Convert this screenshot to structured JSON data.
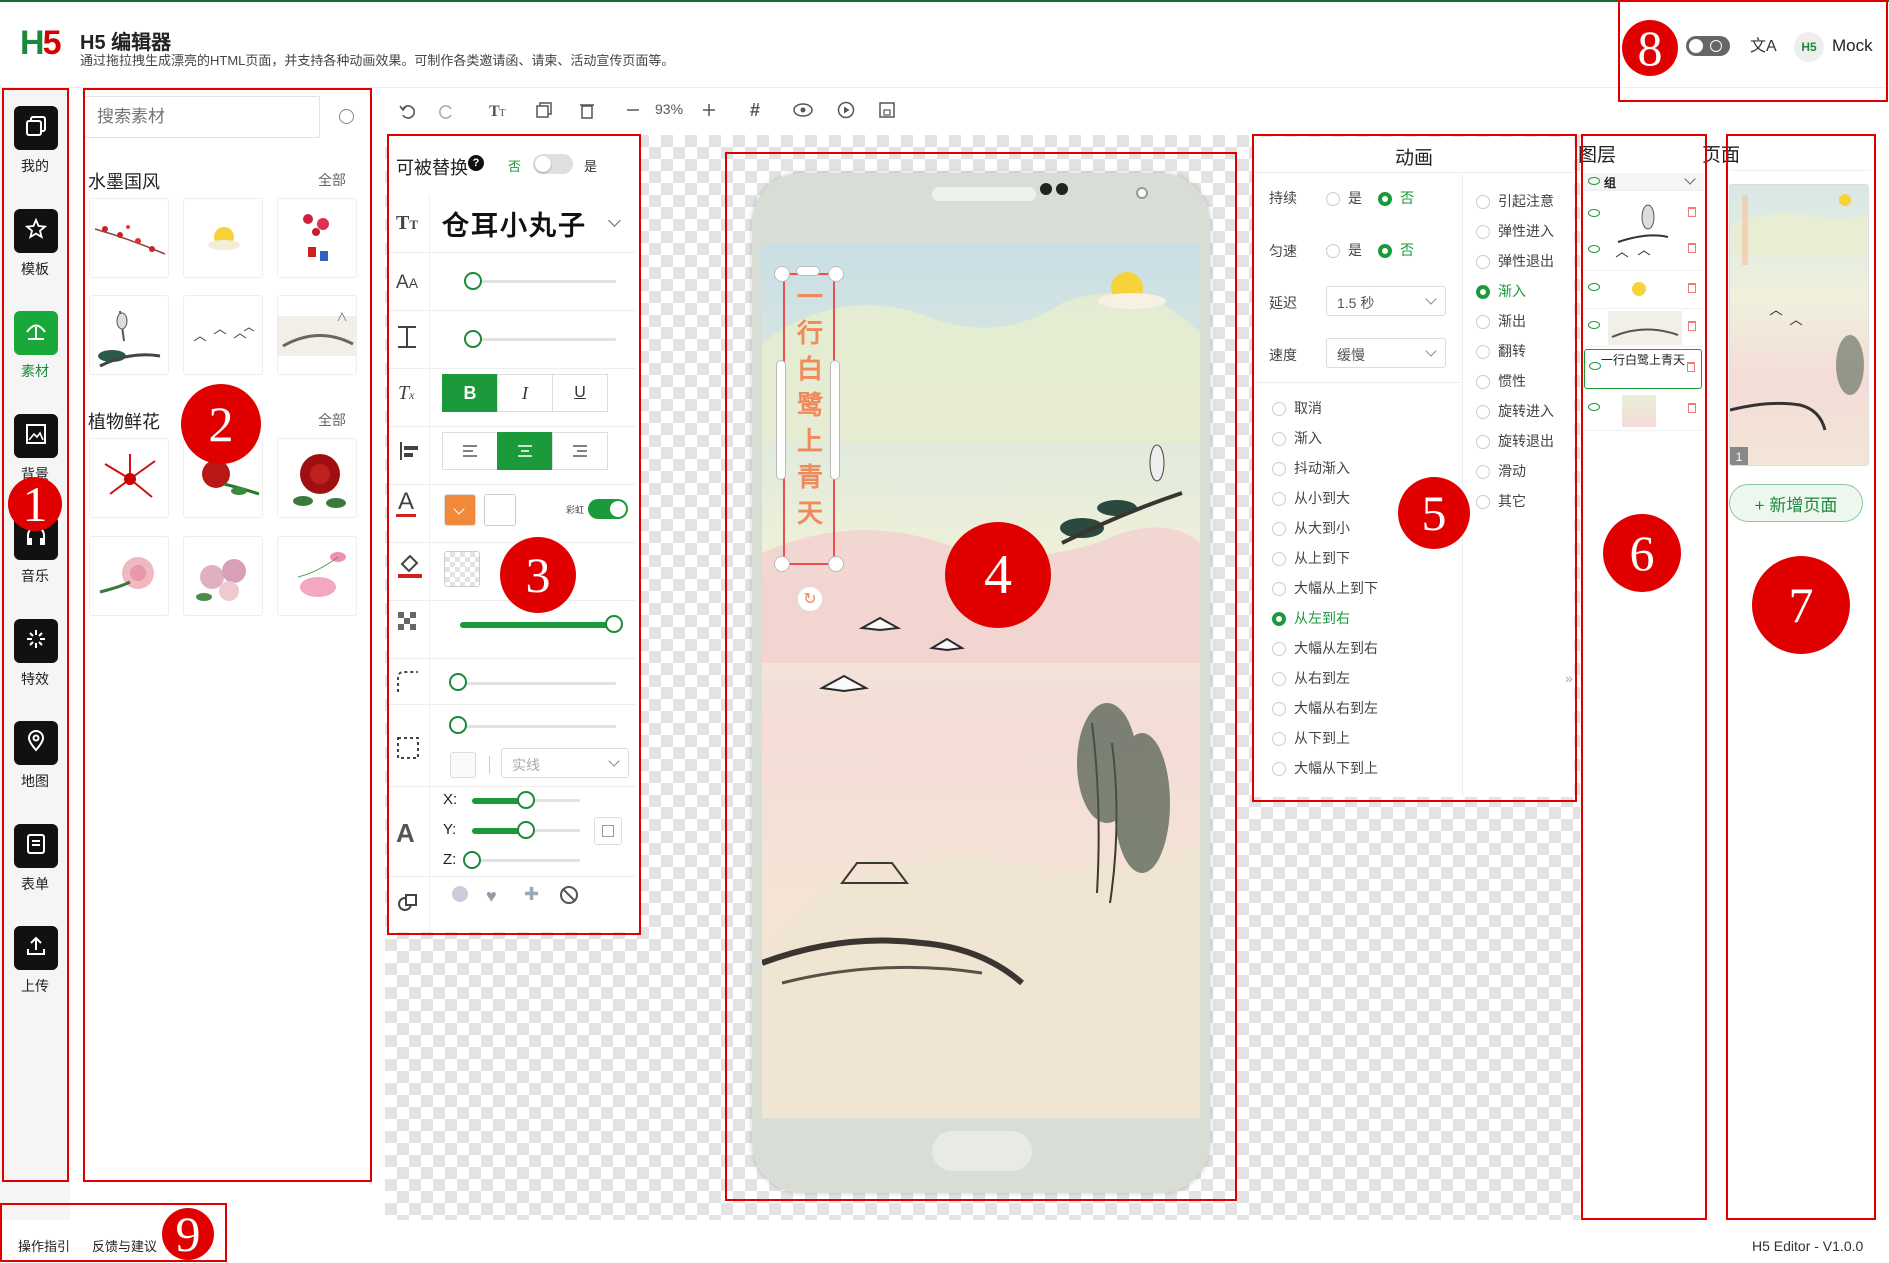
{
  "header": {
    "logo_h": "H",
    "logo_5": "5",
    "title": "H5 编辑器",
    "subtitle": "通过拖拉拽生成漂亮的HTML页面，并支持各种动画效果。可制作各类邀请函、请柬、活动宣传页面等。",
    "user_logo": "H5",
    "user": "Mock",
    "translate_glyph": "文A"
  },
  "nav": [
    {
      "label": "我的",
      "icon": "copy-icon"
    },
    {
      "label": "模板",
      "icon": "star-icon"
    },
    {
      "label": "素材",
      "icon": "umbrella-icon",
      "active": true
    },
    {
      "label": "背景",
      "icon": "image-icon"
    },
    {
      "label": "音乐",
      "icon": "headphones-icon"
    },
    {
      "label": "特效",
      "icon": "sparkle-icon"
    },
    {
      "label": "地图",
      "icon": "map-pin-icon"
    },
    {
      "label": "表单",
      "icon": "form-icon"
    },
    {
      "label": "上传",
      "icon": "upload-icon"
    }
  ],
  "materials": {
    "search_placeholder": "搜索素材",
    "sections": [
      {
        "title": "水墨国风",
        "more": "全部"
      },
      {
        "title": "植物鲜花",
        "more": "全部"
      }
    ]
  },
  "toolbar": {
    "zoom": "93%",
    "grid": "#"
  },
  "props": {
    "replaceable_label": "可被替换",
    "help": "?",
    "no": "否",
    "yes": "是",
    "font_name": "仓耳小丸子",
    "bold": "B",
    "italic": "I",
    "underline": "U",
    "stroke_toggle_label": "彩虹",
    "border_style": "实线",
    "x_label": "X:",
    "y_label": "Y:",
    "z_label": "Z:",
    "font_size_pct": 0.06,
    "line_height_pct": 0.06,
    "opacity_pct": 1.0,
    "radius_pct": 0.0,
    "border_pct": 0.0,
    "rot_x_pct": 0.5,
    "rot_y_pct": 0.5,
    "rot_z_pct": 0.0,
    "accent": "#1a9a3a",
    "swatch_color": "#f08a3a"
  },
  "canvas": {
    "vertical_text": "一行白鹭上青天",
    "text_color": "#f08a5a"
  },
  "animation": {
    "title": "动画",
    "persist_label": "持续",
    "uniform_label": "匀速",
    "delay_label": "延迟",
    "speed_label": "速度",
    "yes": "是",
    "no": "否",
    "delay_value": "1.5 秒",
    "speed_value": "缓慢",
    "left_options": [
      "取消",
      "渐入",
      "抖动渐入",
      "从小到大",
      "从大到小",
      "从上到下",
      "大幅从上到下",
      "从左到右",
      "大幅从左到右",
      "从右到左",
      "大幅从右到左",
      "从下到上",
      "大幅从下到上"
    ],
    "left_selected": "从左到右",
    "right_options": [
      "引起注意",
      "弹性进入",
      "弹性退出",
      "渐入",
      "渐出",
      "翻转",
      "惯性",
      "旋转进入",
      "旋转退出",
      "滑动",
      "其它"
    ],
    "right_selected": "渐入"
  },
  "layers": {
    "title": "图层",
    "group": "组",
    "text_layer": "一行白鹭上青天",
    "collapse": "»"
  },
  "pages": {
    "title": "页面",
    "page_number": "1",
    "add_page": "+ 新增页面"
  },
  "footer": {
    "guide": "操作指引",
    "feedback": "反馈与建议",
    "version": "H5 Editor - V1.0.0"
  },
  "markers": [
    "1",
    "2",
    "3",
    "4",
    "5",
    "6",
    "7",
    "8",
    "9"
  ]
}
